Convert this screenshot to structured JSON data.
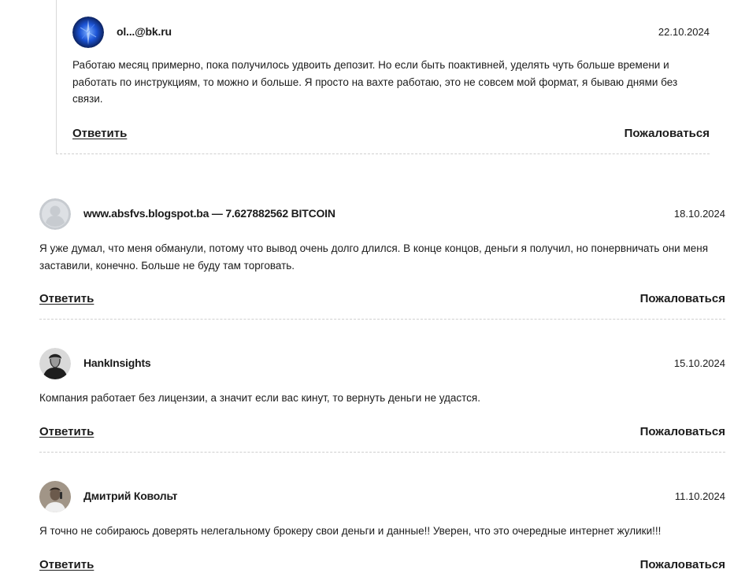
{
  "comments": [
    {
      "author": "ol...@bk.ru",
      "date": "22.10.2024",
      "text": "Работаю месяц примерно, пока получилось удвоить депозит. Но если быть поактивней, уделять чуть больше времени и работать по инструкциям, то можно и больше. Я просто на вахте работаю, это не совсем мой формат, я бываю днями без связи.",
      "avatar_icon": "blue-abstract-avatar",
      "reply_label": "Ответить",
      "report_label": "Пожаловаться"
    },
    {
      "author": "www.absfvs.blogspot.ba — 7.627882562 BITCOIN",
      "date": "18.10.2024",
      "text": "Я уже думал, что меня обманули, потому что вывод очень долго длился. В конце концов, деньги я получил, но понервничать они меня заставили, конечно. Больше не буду там торговать.",
      "avatar_icon": "default-user-icon",
      "reply_label": "Ответить",
      "report_label": "Пожаловаться"
    },
    {
      "author": "HankInsights",
      "date": "15.10.2024",
      "text": "Компания работает без лицензии, а значит если вас кинут, то вернуть деньги не удастся.",
      "avatar_icon": "photo-avatar",
      "reply_label": "Ответить",
      "report_label": "Пожаловаться"
    },
    {
      "author": "Дмитрий Ковольт",
      "date": "11.10.2024",
      "text": "Я точно не собираюсь доверять нелегальному брокеру свои деньги и данные!! Уверен, что это очередные интернет жулики!!!",
      "avatar_icon": "photo-avatar",
      "reply_label": "Ответить",
      "report_label": "Пожаловаться"
    }
  ],
  "colors": {
    "text": "#1b1b1b",
    "divider": "#cfcfcf",
    "avatar_default": "#c7cbd0"
  }
}
